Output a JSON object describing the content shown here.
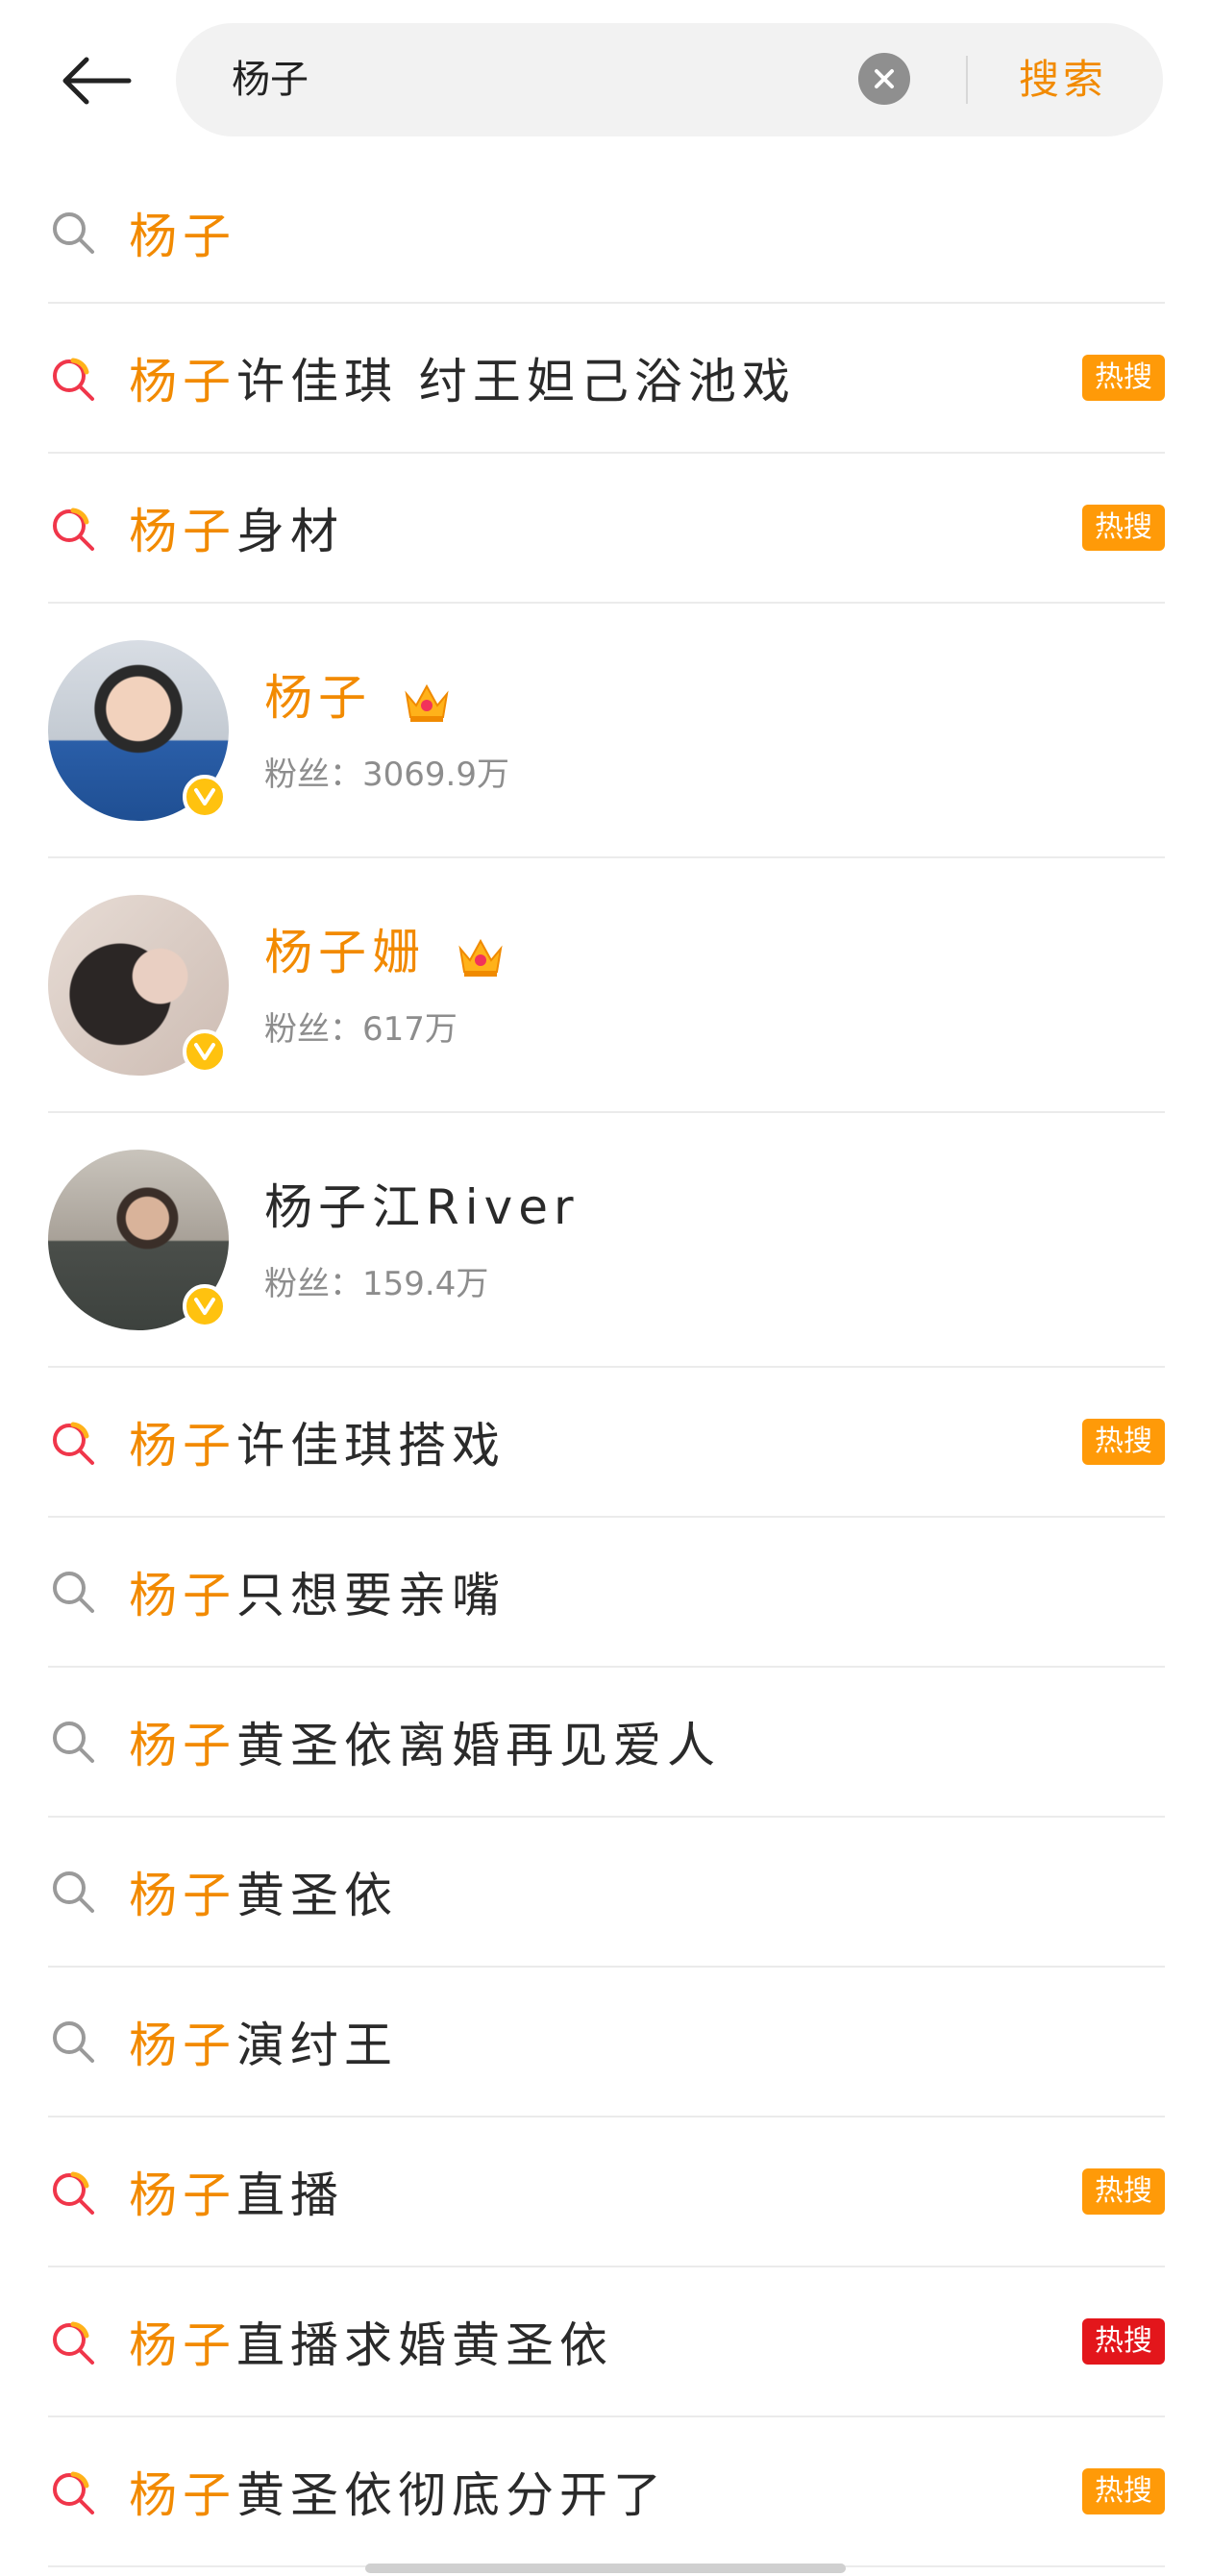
{
  "search": {
    "query": "杨子",
    "submit_label": "搜索"
  },
  "suggestions_top": [
    {
      "icon": "search-icon",
      "highlight": "杨子",
      "rest": "",
      "badge": null
    },
    {
      "icon": "hot-search-icon",
      "highlight": "杨子",
      "rest": "许佳琪 纣王妲己浴池戏",
      "badge": "热搜",
      "badge_color": "#ff9a08"
    },
    {
      "icon": "hot-search-icon",
      "highlight": "杨子",
      "rest": "身材",
      "badge": "热搜",
      "badge_color": "#ff9a08"
    }
  ],
  "users": [
    {
      "name": "杨子",
      "name_color": "orange",
      "crown": true,
      "fans_label": "粉丝：3069.9万",
      "verified": true
    },
    {
      "name": "杨子姗",
      "name_color": "orange",
      "crown": true,
      "fans_label": "粉丝：617万",
      "verified": true
    },
    {
      "name": "杨子江River",
      "name_color": "dark",
      "crown": false,
      "fans_label": "粉丝：159.4万",
      "verified": true
    }
  ],
  "suggestions_bottom": [
    {
      "icon": "hot-search-icon",
      "highlight": "杨子",
      "rest": "许佳琪搭戏",
      "badge": "热搜",
      "badge_color": "#ff9a08"
    },
    {
      "icon": "search-icon",
      "highlight": "杨子",
      "rest": "只想要亲嘴",
      "badge": null
    },
    {
      "icon": "search-icon",
      "highlight": "杨子",
      "rest": "黄圣依离婚再见爱人",
      "badge": null
    },
    {
      "icon": "search-icon",
      "highlight": "杨子",
      "rest": "黄圣依",
      "badge": null
    },
    {
      "icon": "search-icon",
      "highlight": "杨子",
      "rest": "演纣王",
      "badge": null
    },
    {
      "icon": "hot-search-icon",
      "highlight": "杨子",
      "rest": "直播",
      "badge": "热搜",
      "badge_color": "#ff9a08"
    },
    {
      "icon": "hot-search-icon",
      "highlight": "杨子",
      "rest": "直播求婚黄圣依",
      "badge": "热搜",
      "badge_color": "#e3161b"
    },
    {
      "icon": "hot-search-icon",
      "highlight": "杨子",
      "rest": "黄圣依彻底分开了",
      "badge": "热搜",
      "badge_color": "#ff9a08"
    }
  ],
  "colors": {
    "accent": "#f28a00",
    "hot_orange": "#ff9a08",
    "hot_red": "#e3161b",
    "verify": "#ffc20f"
  }
}
